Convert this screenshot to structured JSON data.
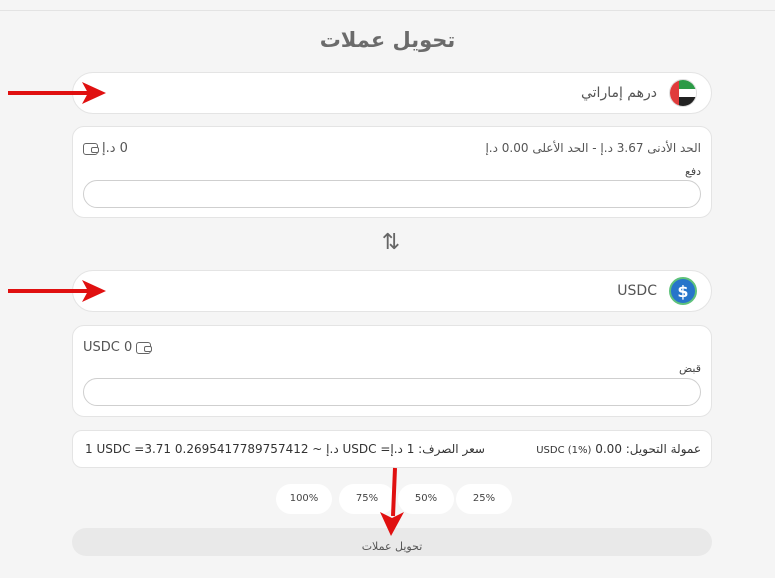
{
  "title": "تحويل عملات",
  "from": {
    "currency_label": "درهم إماراتي",
    "balance": "0 د.إ",
    "limits": "الحد الأدنى 3.67 د.إ   -   الحد الأعلى 0.00 د.إ",
    "field_label": "دفع",
    "input_value": "",
    "icon": "uae-flag-icon"
  },
  "to": {
    "currency_label": "USDC",
    "balance": "USDC 0",
    "field_label": "قبض",
    "input_value": "",
    "icon": "usdc-icon"
  },
  "swap_icon": "⇅",
  "rate": {
    "fee": "عمولة التحويل: 0.00",
    "fee_value": "USDC (1%)",
    "exchange": "1 USDC =3.71 د.إ ~ 0.2695417789757412 USDC =سعر الصرف: 1 د.إ"
  },
  "percent_buttons": [
    "100%",
    "75%",
    "50%",
    "25%"
  ],
  "convert_label": "تحويل عملات",
  "colors": {
    "arrow": "#e01010",
    "usdc": "#2775ca"
  }
}
